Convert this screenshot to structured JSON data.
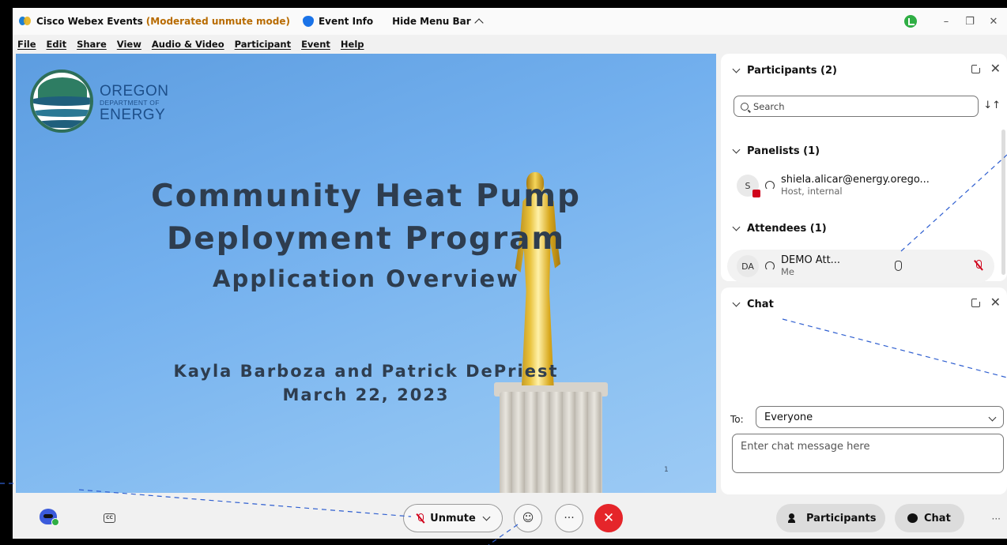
{
  "titlebar": {
    "app_name": "Cisco Webex Events",
    "mode": "(Moderated unmute mode)",
    "event_info": "Event Info",
    "hide_menu": "Hide Menu Bar",
    "minimize": "–",
    "restore": "❐",
    "close": "✕"
  },
  "menu": [
    "File",
    "Edit",
    "Share",
    "View",
    "Audio & Video",
    "Participant",
    "Event",
    "Help"
  ],
  "slide": {
    "org_line1": "OREGON",
    "org_line2": "DEPARTMENT OF",
    "org_line3": "ENERGY",
    "title1": "Community Heat Pump",
    "title2": "Deployment Program",
    "title3": "Application Overview",
    "presenters": "Kayla Barboza and Patrick DePriest",
    "date": "March 22, 2023",
    "page_number": "1"
  },
  "participants_panel": {
    "title": "Participants (2)",
    "search_placeholder": "Search",
    "sort": "↓↑",
    "panelists_header": "Panelists (1)",
    "attendees_header": "Attendees (1)",
    "panelist": {
      "initial": "S",
      "name": "shiela.alicar@energy.orego...",
      "role": "Host, internal"
    },
    "attendee": {
      "initial": "DA",
      "name": "DEMO Att...",
      "role": "Me"
    }
  },
  "chat_panel": {
    "title": "Chat",
    "to_label": "To:",
    "to_value": "Everyone",
    "input_placeholder": "Enter chat message here"
  },
  "bottombar": {
    "cc": "CC",
    "unmute": "Unmute",
    "emoji": "☺",
    "more": "···",
    "leave": "✕",
    "participants": "Participants",
    "chat": "Chat",
    "overflow": "···"
  },
  "colors": {
    "accent": "#1a73e8",
    "mode_text": "#b86b00",
    "leave": "#e5252a",
    "mic_off": "#d0021b"
  }
}
